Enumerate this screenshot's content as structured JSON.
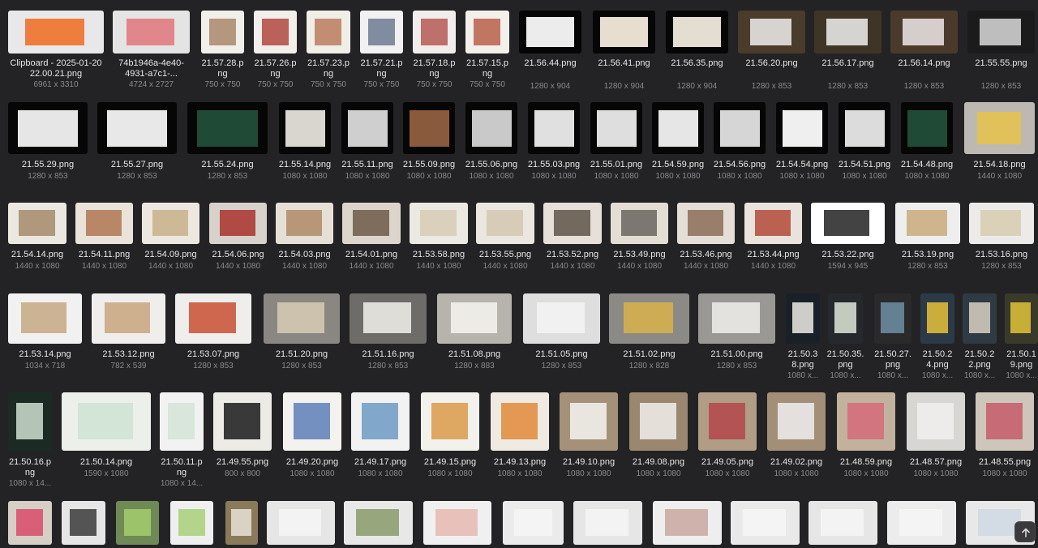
{
  "rows": [
    [
      {
        "name": "Clipboard - 2025-01-20 22.00.21.png",
        "dims": "6961 x 3310",
        "bg": "#e8e8ea",
        "fg": "#f06a1e"
      },
      {
        "name": "74b1946a-4e40-4931-a7c1-...",
        "dims": "4724 x 2727",
        "bg": "#e4e4e4",
        "fg": "#e0767a"
      },
      {
        "name": "21.57.28.png",
        "dims": "750 x 750",
        "bg": "#f1efec",
        "fg": "#a9876a"
      },
      {
        "name": "21.57.26.png",
        "dims": "750 x 750",
        "bg": "#f2eeec",
        "fg": "#b0483f"
      },
      {
        "name": "21.57.23.png",
        "dims": "750 x 750",
        "bg": "#f1ede7",
        "fg": "#b97d5f"
      },
      {
        "name": "21.57.21.png",
        "dims": "750 x 750",
        "bg": "#f2f1f2",
        "fg": "#6d7a93"
      },
      {
        "name": "21.57.18.png",
        "dims": "750 x 750",
        "bg": "#f1edec",
        "fg": "#b45a54"
      },
      {
        "name": "21.57.15.png",
        "dims": "750 x 750",
        "bg": "#f3f0ec",
        "fg": "#b86049"
      },
      {
        "name": "21.56.44.png",
        "dims": "1280 x 904",
        "bg": "#0a0a0a",
        "fg": "#ececec",
        "dark": true
      },
      {
        "name": "21.56.41.png",
        "dims": "1280 x 904",
        "bg": "#0a0a0a",
        "fg": "#e7ded0",
        "dark": true
      },
      {
        "name": "21.56.35.png",
        "dims": "1280 x 904",
        "bg": "#0a0a0a",
        "fg": "#e4ddd1",
        "dark": true
      },
      {
        "name": "21.56.20.png",
        "dims": "1280 x 853",
        "bg": "#4a3b2a",
        "fg": "#efefef"
      },
      {
        "name": "21.56.17.png",
        "dims": "1280 x 853",
        "bg": "#3f3526",
        "fg": "#f0f0f0"
      },
      {
        "name": "21.56.14.png",
        "dims": "1280 x 853",
        "bg": "#4b3a2a",
        "fg": "#efe9ea"
      },
      {
        "name": "21.55.55.png",
        "dims": "1280 x 853",
        "bg": "#1b1b1b",
        "fg": "#dadada"
      }
    ],
    [
      {
        "name": "21.55.29.png",
        "dims": "1280 x 853",
        "bg": "#0a0a0a",
        "fg": "#e6e6e6",
        "dark": true
      },
      {
        "name": "21.55.27.png",
        "dims": "1280 x 853",
        "bg": "#0a0a0a",
        "fg": "#e8e8e8",
        "dark": true
      },
      {
        "name": "21.55.24.png",
        "dims": "1280 x 853",
        "bg": "#0a0a0a",
        "fg": "#1f4a35",
        "dark": true
      },
      {
        "name": "21.55.14.png",
        "dims": "1080 x 1080",
        "bg": "#0a0a0a",
        "fg": "#d9d6d0",
        "dark": true
      },
      {
        "name": "21.55.11.png",
        "dims": "1080 x 1080",
        "bg": "#0a0a0a",
        "fg": "#cfcfcf",
        "dark": true
      },
      {
        "name": "21.55.09.png",
        "dims": "1080 x 1080",
        "bg": "#0a0a0a",
        "fg": "#8a5a3c",
        "dark": true
      },
      {
        "name": "21.55.06.png",
        "dims": "1080 x 1080",
        "bg": "#0a0a0a",
        "fg": "#c9c9c9",
        "dark": true
      },
      {
        "name": "21.55.03.png",
        "dims": "1080 x 1080",
        "bg": "#0a0a0a",
        "fg": "#e0e0e0",
        "dark": true
      },
      {
        "name": "21.55.01.png",
        "dims": "1080 x 1080",
        "bg": "#0a0a0a",
        "fg": "#dedede",
        "dark": true
      },
      {
        "name": "21.54.59.png",
        "dims": "1080 x 1080",
        "bg": "#0a0a0a",
        "fg": "#e6e6e6",
        "dark": true
      },
      {
        "name": "21.54.56.png",
        "dims": "1080 x 1080",
        "bg": "#0a0a0a",
        "fg": "#d6d6d6",
        "dark": true
      },
      {
        "name": "21.54.54.png",
        "dims": "1080 x 1080",
        "bg": "#0a0a0a",
        "fg": "#efefef",
        "dark": true
      },
      {
        "name": "21.54.51.png",
        "dims": "1080 x 1080",
        "bg": "#0a0a0a",
        "fg": "#dcdcdc",
        "dark": true
      },
      {
        "name": "21.54.48.png",
        "dims": "1080 x 1080",
        "bg": "#0a0a0a",
        "fg": "#1f4a35",
        "dark": true
      },
      {
        "name": "21.54.18.png",
        "dims": "1440 x 1080",
        "bg": "#bdb9b2",
        "fg": "#e8c24a"
      }
    ],
    [
      {
        "name": "21.54.14.png",
        "dims": "1440 x 1080",
        "bg": "#ebe7e1",
        "fg": "#a58a6a"
      },
      {
        "name": "21.54.11.png",
        "dims": "1440 x 1080",
        "bg": "#e9e3da",
        "fg": "#b07752"
      },
      {
        "name": "21.54.09.png",
        "dims": "1440 x 1080",
        "bg": "#ece7df",
        "fg": "#c9b08a"
      },
      {
        "name": "21.54.06.png",
        "dims": "1440 x 1080",
        "bg": "#d8d2cc",
        "fg": "#a8332b"
      },
      {
        "name": "21.54.03.png",
        "dims": "1440 x 1080",
        "bg": "#e5dfd6",
        "fg": "#b08a67"
      },
      {
        "name": "21.54.01.png",
        "dims": "1440 x 1080",
        "bg": "#ddd5cb",
        "fg": "#6d5a4a"
      },
      {
        "name": "21.53.58.png",
        "dims": "1440 x 1080",
        "bg": "#ece8e2",
        "fg": "#d8cbb5"
      },
      {
        "name": "21.53.55.png",
        "dims": "1440 x 1080",
        "bg": "#ebe6df",
        "fg": "#d4c7b2"
      },
      {
        "name": "21.53.52.png",
        "dims": "1440 x 1080",
        "bg": "#e6e0d8",
        "fg": "#5e534a"
      },
      {
        "name": "21.53.49.png",
        "dims": "1440 x 1080",
        "bg": "#e4ddd3",
        "fg": "#6b6560"
      },
      {
        "name": "21.53.46.png",
        "dims": "1440 x 1080",
        "bg": "#e5ded6",
        "fg": "#8b6d58"
      },
      {
        "name": "21.53.44.png",
        "dims": "1440 x 1080",
        "bg": "#e9e3dc",
        "fg": "#b14a3a"
      },
      {
        "name": "21.53.22.png",
        "dims": "1594 x 945",
        "bg": "#ffffff",
        "fg": "#222222"
      },
      {
        "name": "21.53.19.png",
        "dims": "1280 x 853",
        "bg": "#eeeeee",
        "fg": "#c9aa7d"
      },
      {
        "name": "21.53.16.png",
        "dims": "1280 x 853",
        "bg": "#ecebea",
        "fg": "#d8ccb0"
      }
    ],
    [
      {
        "name": "21.53.14.png",
        "dims": "1034 x 718",
        "bg": "#f1f1f1",
        "fg": "#c5a883"
      },
      {
        "name": "21.53.12.png",
        "dims": "782 x 539",
        "bg": "#efeeec",
        "fg": "#c8a47e"
      },
      {
        "name": "21.53.07.png",
        "dims": "1280 x 853",
        "bg": "#efeeec",
        "fg": "#c94f32"
      },
      {
        "name": "21.51.20.png",
        "dims": "1280 x 853",
        "bg": "#8a8783",
        "fg": "#d8ccb5"
      },
      {
        "name": "21.51.16.png",
        "dims": "1280 x 853",
        "bg": "#6e6c69",
        "fg": "#f3f1ec"
      },
      {
        "name": "21.51.08.png",
        "dims": "1280 x 883",
        "bg": "#b7b3ad",
        "fg": "#f6f4f0"
      },
      {
        "name": "21.51.05.png",
        "dims": "1280 x 853",
        "bg": "#dedede",
        "fg": "#f5f5f5"
      },
      {
        "name": "21.51.02.png",
        "dims": "1280 x 828",
        "bg": "#8c8a86",
        "fg": "#d9b24b"
      },
      {
        "name": "21.51.00.png",
        "dims": "1280 x 853",
        "bg": "#9a9894",
        "fg": "#f0efec"
      },
      {
        "name": "21.50.38.png",
        "dims": "1080 x...",
        "bg": "#1a2027",
        "fg": "#efece6"
      },
      {
        "name": "21.50.35.png",
        "dims": "1080 x...",
        "bg": "#25292d",
        "fg": "#dfe6d8"
      },
      {
        "name": "21.50.27.png",
        "dims": "1080 x...",
        "bg": "#2a2a2a",
        "fg": "#6f8fa6"
      },
      {
        "name": "21.50.24.png",
        "dims": "1080 x...",
        "bg": "#2c3a48",
        "fg": "#e8c23a"
      },
      {
        "name": "21.50.22.png",
        "dims": "1080 x...",
        "bg": "#2f3a44",
        "fg": "#d9d2c2"
      },
      {
        "name": "21.50.19.png",
        "dims": "1080 x...",
        "bg": "#3a3a2a",
        "fg": "#e0c43a"
      }
    ],
    [
      {
        "name": "21.50.16.png",
        "dims": "1080 x 14...",
        "bg": "#1c2a24",
        "fg": "#cfe0d2"
      },
      {
        "name": "21.50.14.png",
        "dims": "1590 x 1080",
        "bg": "#ecefea",
        "fg": "#cfe3d4"
      },
      {
        "name": "21.50.11.png",
        "dims": "1080 x 14...",
        "bg": "#f2f2f2",
        "fg": "#d4e4d8"
      },
      {
        "name": "21.49.55.png",
        "dims": "800 x 800",
        "bg": "#ecebe6",
        "fg": "#1a1a1a"
      },
      {
        "name": "21.49.20.png",
        "dims": "1080 x 1080",
        "bg": "#f4f2ee",
        "fg": "#5c7fb8"
      },
      {
        "name": "21.49.17.png",
        "dims": "1080 x 1080",
        "bg": "#f2f2f2",
        "fg": "#6d9bc4"
      },
      {
        "name": "21.49.15.png",
        "dims": "1080 x 1080",
        "bg": "#f3f1ec",
        "fg": "#d99a4a"
      },
      {
        "name": "21.49.13.png",
        "dims": "1080 x 1080",
        "bg": "#efeae2",
        "fg": "#e08a3a"
      },
      {
        "name": "21.49.10.png",
        "dims": "1080 x 1080",
        "bg": "#a5917a",
        "fg": "#f5f4f1"
      },
      {
        "name": "21.49.08.png",
        "dims": "1080 x 1080",
        "bg": "#9b876f",
        "fg": "#f1efeb"
      },
      {
        "name": "21.49.05.png",
        "dims": "1080 x 1080",
        "bg": "#b19d86",
        "fg": "#b5464a"
      },
      {
        "name": "21.49.02.png",
        "dims": "1080 x 1080",
        "bg": "#a38f78",
        "fg": "#efefef"
      },
      {
        "name": "21.48.59.png",
        "dims": "1080 x 1080",
        "bg": "#c2b29d",
        "fg": "#d56a7a"
      },
      {
        "name": "21.48.57.png",
        "dims": "1080 x 1080",
        "bg": "#d8d6d2",
        "fg": "#f1f0ee"
      },
      {
        "name": "21.48.55.png",
        "dims": "1080 x 1080",
        "bg": "#cfc6bb",
        "fg": "#c65a6a"
      }
    ],
    [
      {
        "name": "",
        "dims": "",
        "bg": "#d6cfc6",
        "fg": "#d94a6a"
      },
      {
        "name": "",
        "dims": "",
        "bg": "#e6e6e6",
        "fg": "#3a3a3a"
      },
      {
        "name": "",
        "dims": "",
        "bg": "#6f8a55",
        "fg": "#a6cc6e"
      },
      {
        "name": "",
        "dims": "",
        "bg": "#efefef",
        "fg": "#a8cf78"
      },
      {
        "name": "",
        "dims": "",
        "bg": "#8a7a5a",
        "fg": "#e8e2d8"
      },
      {
        "name": "",
        "dims": "",
        "bg": "#e6e6e6",
        "fg": "#f5f5f5"
      },
      {
        "name": "",
        "dims": "",
        "bg": "#e8e8e8",
        "fg": "#8a9a6a"
      },
      {
        "name": "",
        "dims": "",
        "bg": "#f0f0f0",
        "fg": "#e6b8b2"
      },
      {
        "name": "",
        "dims": "",
        "bg": "#ebebeb",
        "fg": "#f6f6f6"
      },
      {
        "name": "",
        "dims": "",
        "bg": "#e6e6e6",
        "fg": "#f4f4f4"
      },
      {
        "name": "",
        "dims": "",
        "bg": "#eeeeee",
        "fg": "#c9a7a0"
      },
      {
        "name": "",
        "dims": "",
        "bg": "#e9e9e9",
        "fg": "#f6f6f6"
      },
      {
        "name": "",
        "dims": "",
        "bg": "#e6e6e6",
        "fg": "#f4f4f4"
      },
      {
        "name": "",
        "dims": "",
        "bg": "#ececec",
        "fg": "#f6f6f6"
      },
      {
        "name": "",
        "dims": "",
        "bg": "#e8e8e8",
        "fg": "#cfd9e4"
      }
    ]
  ],
  "scroll_top_icon": "arrow-up-icon"
}
